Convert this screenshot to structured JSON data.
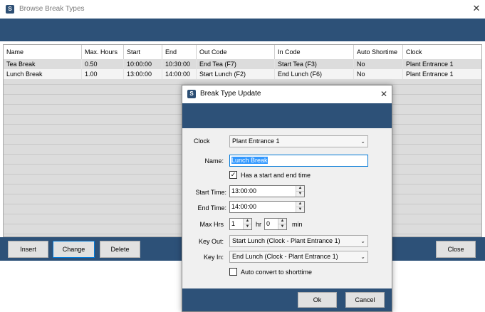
{
  "window": {
    "title": "Browse Break Types",
    "app_icon_glyph": "S",
    "close_glyph": "✕",
    "accent_color": "#2d5178"
  },
  "grid": {
    "columns": [
      "Name",
      "Max. Hours",
      "Start",
      "End",
      "Out Code",
      "In Code",
      "Auto Shortime",
      "Clock"
    ],
    "rows": [
      [
        "Tea Break",
        "0.50",
        "10:00:00",
        "10:30:00",
        "End Tea (F7)",
        "Start Tea (F3)",
        "No",
        "Plant Entrance 1"
      ],
      [
        "Lunch Break",
        "1.00",
        "13:00:00",
        "14:00:00",
        "Start Lunch (F2)",
        "End Lunch (F6)",
        "No",
        "Plant Entrance 1"
      ]
    ],
    "selected_row": 1
  },
  "toolbar": {
    "insert_label": "Insert",
    "change_label": "Change",
    "delete_label": "Delete",
    "close_label": "Close"
  },
  "dialog": {
    "title": "Break Type Update",
    "close_glyph": "✕",
    "clock_label": "Clock",
    "clock_value": "Plant Entrance 1",
    "name_label": "Name:",
    "name_value": "Lunch Break",
    "has_start_end_label": "Has a start and end time",
    "has_start_end_checked": true,
    "start_time_label": "Start Time:",
    "start_time_value": "13:00:00",
    "end_time_label": "End Time:",
    "end_time_value": "14:00:00",
    "max_hrs_label": "Max Hrs",
    "max_hrs_value": "1",
    "hr_label": "hr",
    "max_min_value": "0",
    "min_label": "min",
    "key_out_label": "Key Out:",
    "key_out_value": "Start Lunch (Clock - Plant Entrance 1)",
    "key_in_label": "Key In:",
    "key_in_value": "End Lunch (Clock - Plant Entrance 1)",
    "auto_convert_label": "Auto convert to shorttime",
    "auto_convert_checked": false,
    "ok_label": "Ok",
    "cancel_label": "Cancel"
  }
}
